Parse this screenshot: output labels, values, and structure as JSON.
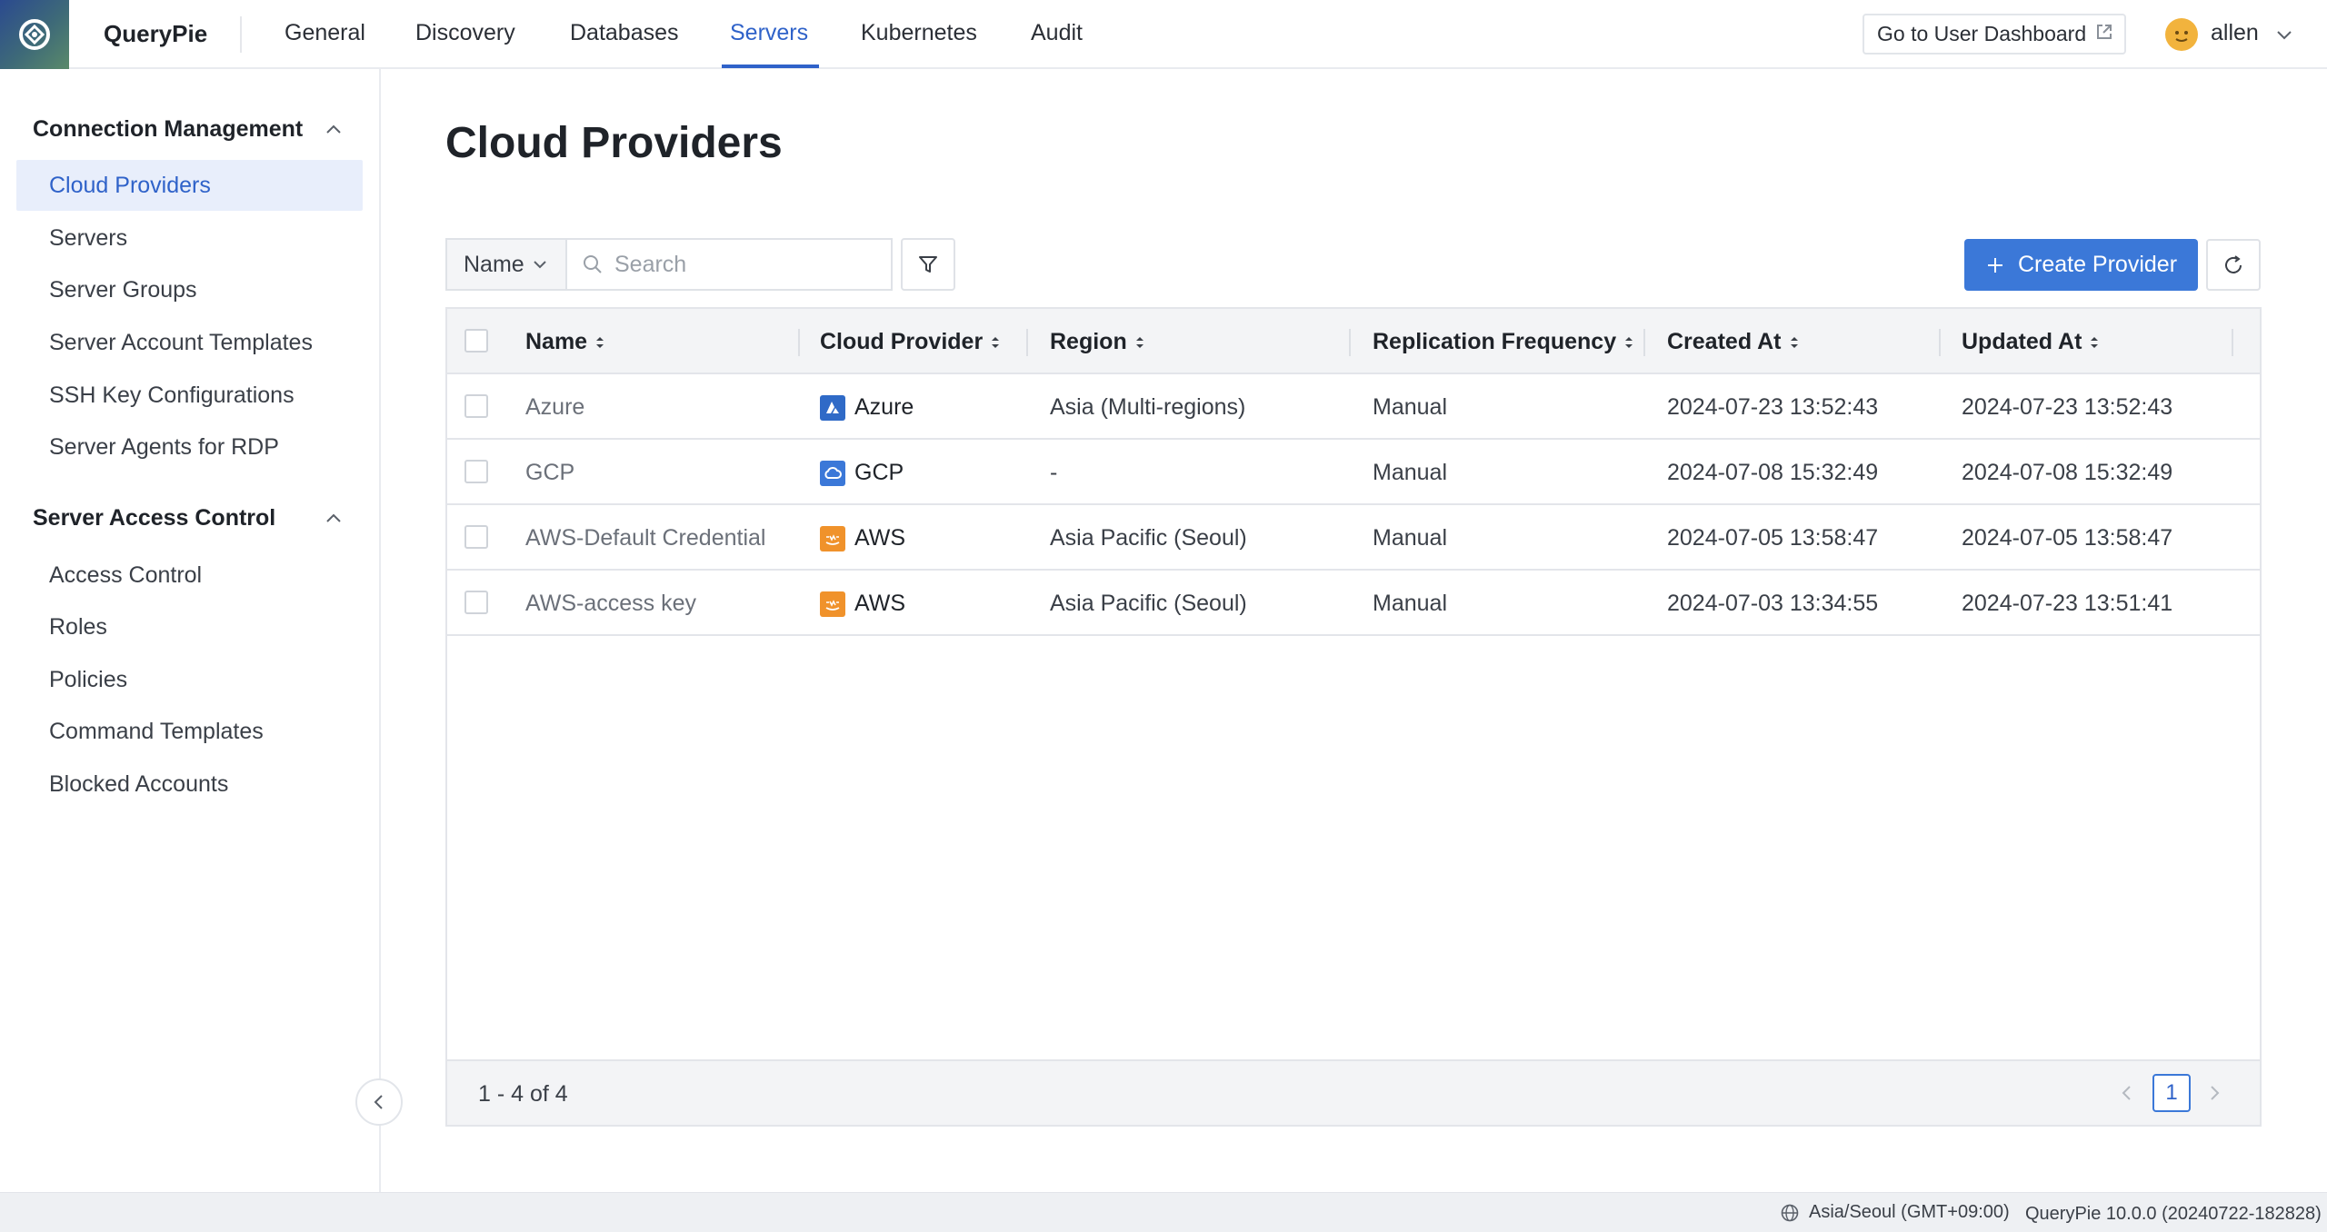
{
  "app": {
    "name": "QueryPie"
  },
  "nav": {
    "tabs": [
      {
        "label": "General"
      },
      {
        "label": "Discovery"
      },
      {
        "label": "Databases"
      },
      {
        "label": "Servers",
        "active": true
      },
      {
        "label": "Kubernetes"
      },
      {
        "label": "Audit"
      }
    ],
    "dashboard_button": "Go to User Dashboard",
    "user": "allen"
  },
  "sidebar": {
    "sections": [
      {
        "title": "Connection Management",
        "items": [
          {
            "label": "Cloud Providers",
            "active": true
          },
          {
            "label": "Servers"
          },
          {
            "label": "Server Groups"
          },
          {
            "label": "Server Account Templates"
          },
          {
            "label": "SSH Key Configurations"
          },
          {
            "label": "Server Agents for RDP"
          }
        ]
      },
      {
        "title": "Server Access Control",
        "items": [
          {
            "label": "Access Control"
          },
          {
            "label": "Roles"
          },
          {
            "label": "Policies"
          },
          {
            "label": "Command Templates"
          },
          {
            "label": "Blocked Accounts"
          }
        ]
      }
    ]
  },
  "main": {
    "title": "Cloud Providers",
    "filter_field": "Name",
    "search_placeholder": "Search",
    "create_button": "Create Provider",
    "table": {
      "columns": [
        "Name",
        "Cloud Provider",
        "Region",
        "Replication Frequency",
        "Created At",
        "Updated At"
      ],
      "rows": [
        {
          "name": "Azure",
          "provider": "Azure",
          "provider_icon": "azure-icon",
          "region": "Asia (Multi-regions)",
          "frequency": "Manual",
          "created": "2024-07-23 13:52:43",
          "updated": "2024-07-23 13:52:43"
        },
        {
          "name": "GCP",
          "provider": "GCP",
          "provider_icon": "gcp-icon",
          "region": "-",
          "frequency": "Manual",
          "created": "2024-07-08 15:32:49",
          "updated": "2024-07-08 15:32:49"
        },
        {
          "name": "AWS-Default Credential",
          "provider": "AWS",
          "provider_icon": "aws-icon",
          "region": "Asia Pacific (Seoul)",
          "frequency": "Manual",
          "created": "2024-07-05 13:58:47",
          "updated": "2024-07-05 13:58:47"
        },
        {
          "name": "AWS-access key",
          "provider": "AWS",
          "provider_icon": "aws-icon",
          "region": "Asia Pacific (Seoul)",
          "frequency": "Manual",
          "created": "2024-07-03 13:34:55",
          "updated": "2024-07-23 13:51:41"
        }
      ],
      "count_text": "1 - 4 of 4",
      "current_page": "1"
    }
  },
  "status": {
    "timezone": "Asia/Seoul (GMT+09:00)",
    "version": "QueryPie 10.0.0 (20240722-182828)"
  },
  "colors": {
    "accent": "#2f62c9",
    "primary_button": "#3b78d8",
    "aws": "#f0922b",
    "azure": "#2f6ac7"
  }
}
